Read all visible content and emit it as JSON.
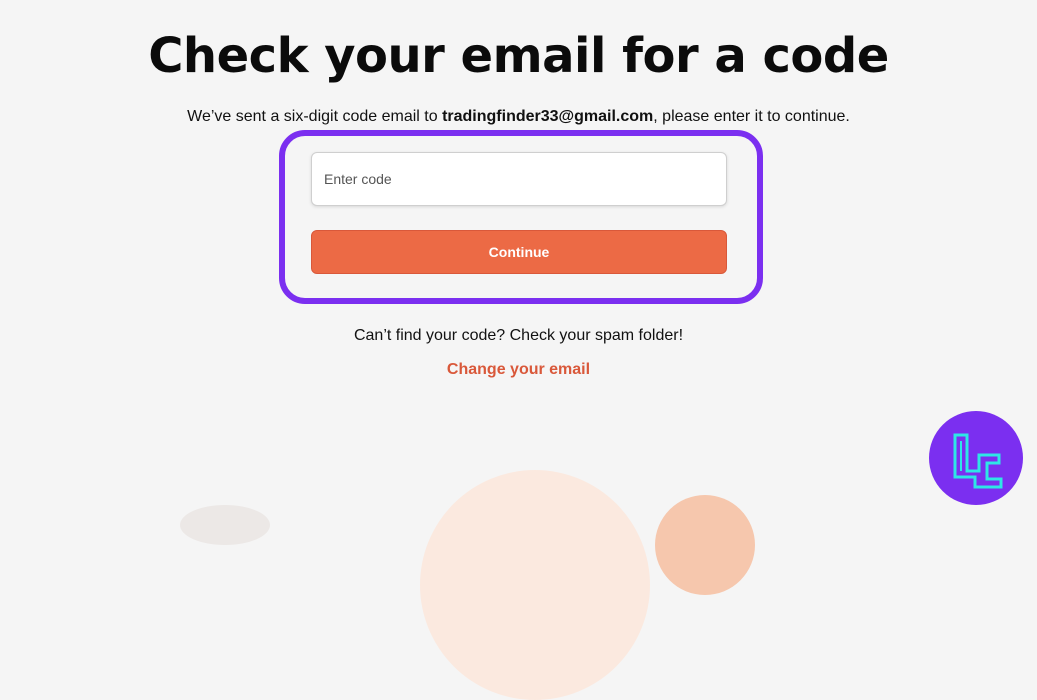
{
  "page": {
    "title": "Check your email for a code",
    "subtitle_prefix": "We’ve sent a six-digit code email to ",
    "email": "tradingfinder33@gmail.com",
    "subtitle_suffix": ", please enter it to continue."
  },
  "form": {
    "code_placeholder": "Enter code",
    "code_value": "",
    "continue_label": "Continue"
  },
  "footer": {
    "spam_hint": "Can’t find your code? Check your spam folder!",
    "change_email_label": "Change your email"
  },
  "colors": {
    "highlight_border": "#7b2ff0",
    "accent": "#ec6a45",
    "link": "#d9583a",
    "logo_bg": "#7b2ff0",
    "logo_mark": "#2ee6e6"
  },
  "icons": {
    "brand_logo": "tradingfinder-logo-icon"
  }
}
